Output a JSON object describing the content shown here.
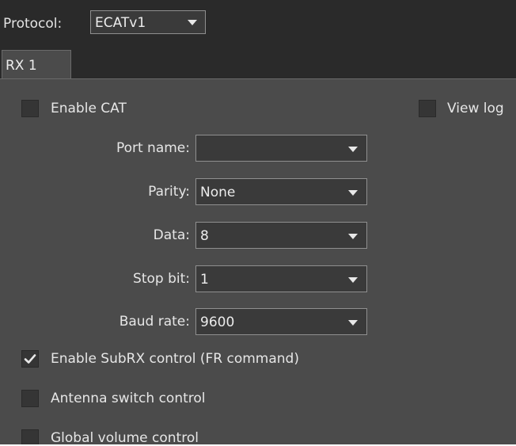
{
  "protocol": {
    "label": "Protocol:",
    "value": "ECATv1"
  },
  "tabs": [
    {
      "label": "RX 1",
      "active": true
    }
  ],
  "enable_cat": {
    "label": "Enable CAT",
    "checked": false
  },
  "view_log": {
    "label": "View log",
    "checked": false
  },
  "fields": {
    "port_name": {
      "label": "Port name:",
      "value": ""
    },
    "parity": {
      "label": "Parity:",
      "value": "None"
    },
    "data": {
      "label": "Data:",
      "value": "8"
    },
    "stop_bit": {
      "label": "Stop bit:",
      "value": "1"
    },
    "baud_rate": {
      "label": "Baud rate:",
      "value": "9600"
    }
  },
  "options": {
    "subrx": {
      "label": "Enable SubRX control (FR command)",
      "checked": true
    },
    "antenna": {
      "label": "Antenna switch control",
      "checked": false
    },
    "global_volume": {
      "label": "Global volume control",
      "checked": false
    }
  },
  "colors": {
    "background": "#4b4b4b",
    "header": "#2a2a2a",
    "combo": "#3a3a3a",
    "text": "#e6e6e6"
  }
}
